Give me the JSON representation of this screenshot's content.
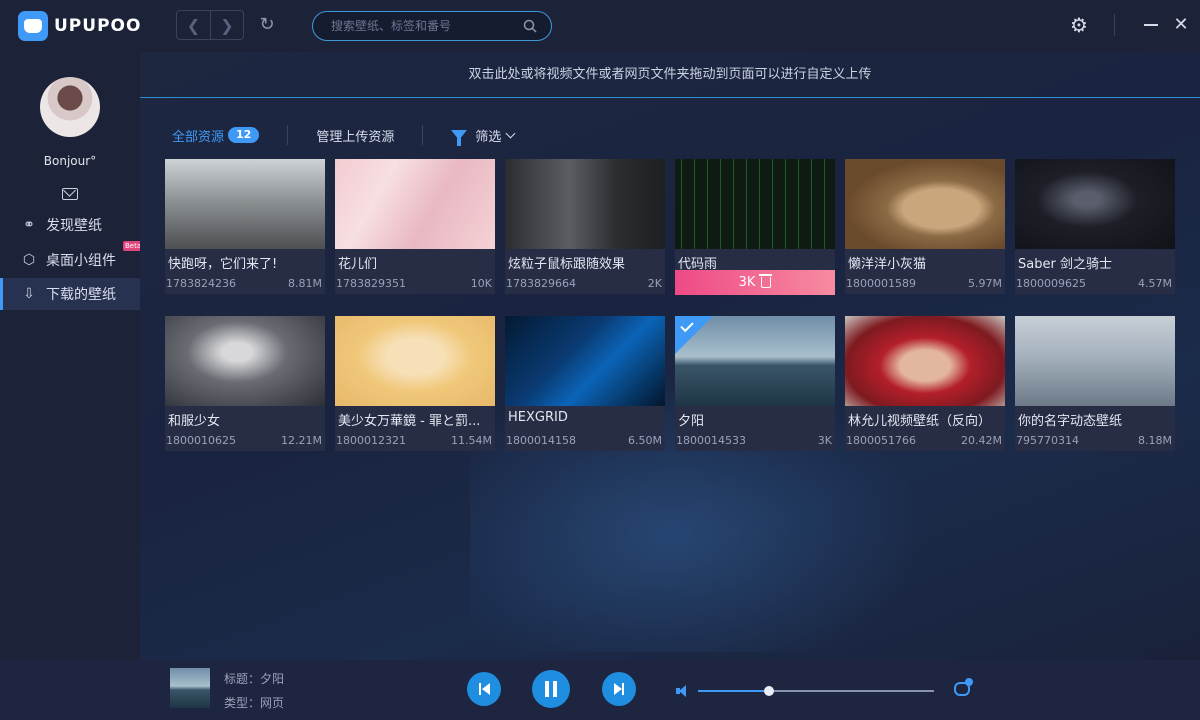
{
  "app": {
    "logo_text": "UPUPOO"
  },
  "titlebar": {
    "search_placeholder": "搜索壁纸、标签和番号",
    "icons": [
      "back-icon",
      "forward-icon",
      "refresh-icon",
      "search-icon",
      "gear-icon",
      "minimize-icon",
      "close-icon"
    ]
  },
  "sidebar": {
    "username": "Bonjour°",
    "items": [
      {
        "label": "发现壁纸",
        "icon": "planet-icon",
        "active": false
      },
      {
        "label": "桌面小组件",
        "icon": "shield-icon",
        "active": false,
        "badge": "Beta"
      },
      {
        "label": "下载的壁纸",
        "icon": "download-icon",
        "active": true
      }
    ]
  },
  "upload_hint": "双击此处或将视频文件或者网页文件夹拖动到页面可以进行自定义上传",
  "tabs": {
    "all_label": "全部资源",
    "all_count": "12",
    "manage_label": "管理上传资源",
    "filter_label": "筛选"
  },
  "wallpapers": [
    {
      "title": "快跑呀，它们来了!",
      "id": "1783824236",
      "size": "8.81M"
    },
    {
      "title": "花儿们",
      "id": "1783829351",
      "size": "10K"
    },
    {
      "title": "炫粒子鼠标跟随效果",
      "id": "1783829664",
      "size": "2K"
    },
    {
      "title": "代码雨",
      "id": "",
      "size": "",
      "hover_size": "3K",
      "hovered": true
    },
    {
      "title": "懒洋洋小灰猫",
      "id": "1800001589",
      "size": "5.97M"
    },
    {
      "title": "Saber 剑之骑士",
      "id": "1800009625",
      "size": "4.57M"
    },
    {
      "title": "和服少女",
      "id": "1800010625",
      "size": "12.21M"
    },
    {
      "title": "美少女万華鏡 - 罪と罰...",
      "id": "1800012321",
      "size": "11.54M"
    },
    {
      "title": "HEXGRID",
      "id": "1800014158",
      "size": "6.50M"
    },
    {
      "title": "夕阳",
      "id": "1800014533",
      "size": "3K",
      "selected": true
    },
    {
      "title": "林允儿视频壁纸（反向）",
      "id": "1800051766",
      "size": "20.42M"
    },
    {
      "title": "你的名字动态壁纸",
      "id": "795770314",
      "size": "8.18M"
    }
  ],
  "player": {
    "title": "标题：夕阳",
    "type": "类型：网页",
    "volume_fraction": 0.3
  }
}
